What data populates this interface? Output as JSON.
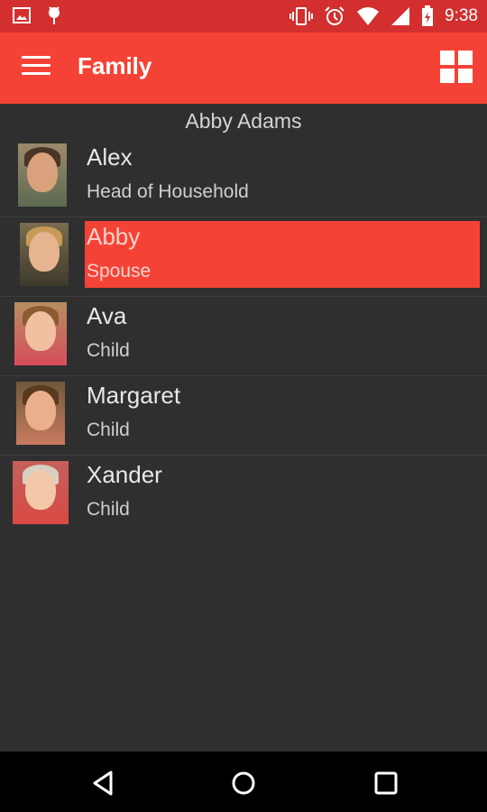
{
  "status_bar": {
    "time": "9:38",
    "left_icons": [
      "image-notification-icon",
      "android-debug-icon"
    ],
    "right_icons": [
      "vibrate-icon",
      "alarm-icon",
      "wifi-icon",
      "signal-icon",
      "battery-icon"
    ]
  },
  "app_bar": {
    "title": "Family",
    "menu_icon": "menu-icon",
    "view_toggle_icon": "grid-view-icon"
  },
  "list": {
    "header": "Abby Adams",
    "members": [
      {
        "name": "Alex",
        "role": "Head of Household",
        "selected": false,
        "photo": "man-portrait"
      },
      {
        "name": "Abby",
        "role": "Spouse",
        "selected": true,
        "photo": "woman-portrait"
      },
      {
        "name": "Ava",
        "role": "Child",
        "selected": false,
        "photo": "girl-portrait"
      },
      {
        "name": "Margaret",
        "role": "Child",
        "selected": false,
        "photo": "girl-portrait"
      },
      {
        "name": "Xander",
        "role": "Child",
        "selected": false,
        "photo": "boy-portrait"
      }
    ]
  },
  "nav_bar": {
    "buttons": [
      "back-icon",
      "home-icon",
      "recents-icon"
    ]
  },
  "colors": {
    "app_bar": "#f44336",
    "status_bar": "#d32f2f",
    "background": "#2f2f2f",
    "selection": "#f44336"
  }
}
